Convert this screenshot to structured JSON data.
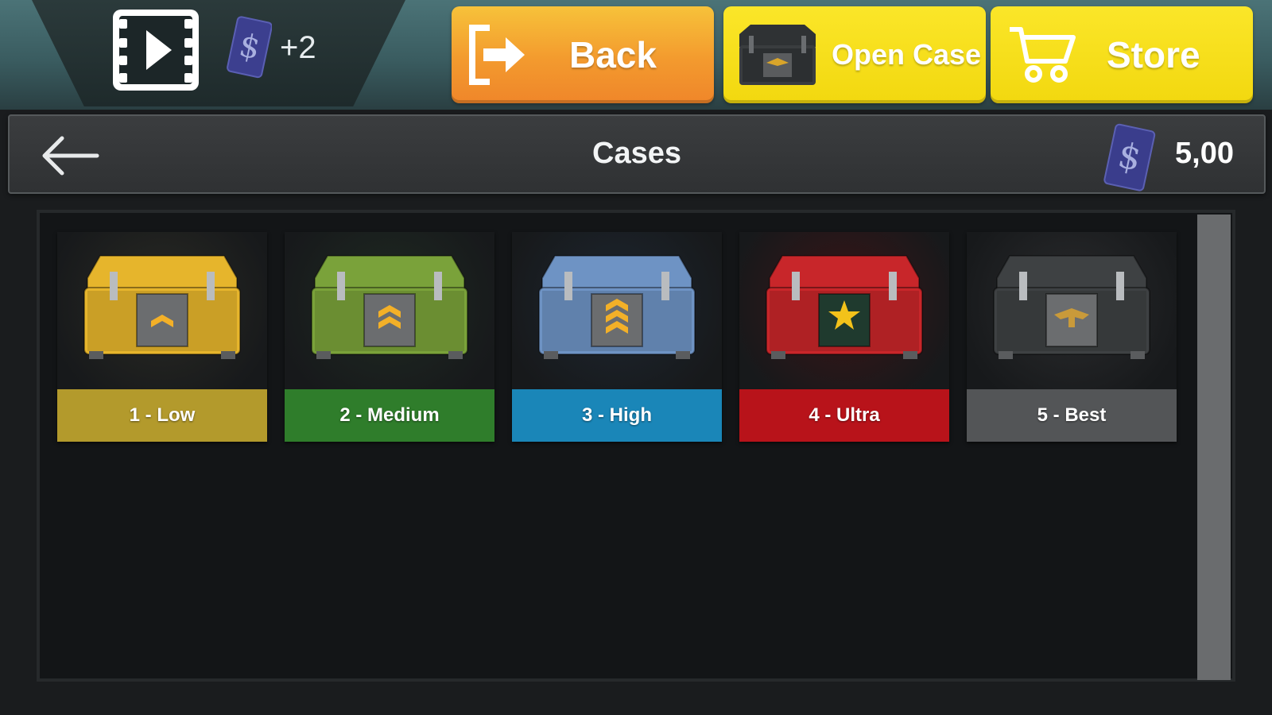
{
  "topbar": {
    "video_icon": "film-play-icon",
    "reward_icon": "dollar-chip-icon",
    "reward_text": "+2",
    "buttons": {
      "back": {
        "label": "Back",
        "icon": "exit-arrow-icon",
        "color": "#f39a2e"
      },
      "open_case": {
        "label": "Open Case",
        "icon": "case-icon",
        "color": "#f2d80f"
      },
      "store": {
        "label": "Store",
        "icon": "shopping-cart-icon",
        "color": "#f2d80f"
      }
    }
  },
  "header": {
    "back_icon": "arrow-left-icon",
    "title": "Cases",
    "balance_icon": "dollar-chip-icon",
    "balance": "5,00"
  },
  "cases": [
    {
      "label": "1 - Low",
      "color": "#b39a2c",
      "box_color": "#e6b52c",
      "emblem": "single-chevron"
    },
    {
      "label": "2 - Medium",
      "color": "#2f7d2b",
      "box_color": "#7aa23a",
      "emblem": "double-chevron"
    },
    {
      "label": "3 - High",
      "color": "#1a86b8",
      "box_color": "#6e93c4",
      "emblem": "triple-chevron"
    },
    {
      "label": "4 - Ultra",
      "color": "#b8131a",
      "box_color": "#c8262a",
      "emblem": "star"
    },
    {
      "label": "5 - Best",
      "color": "#535557",
      "box_color": "#3e4143",
      "emblem": "eagle"
    }
  ]
}
